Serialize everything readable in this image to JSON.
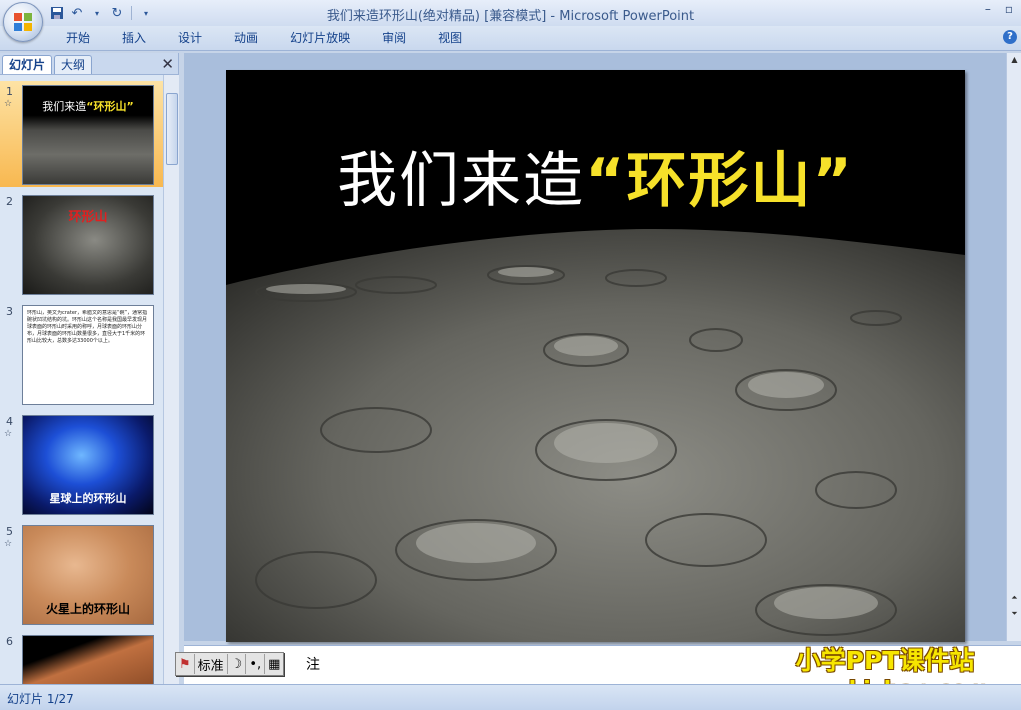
{
  "window": {
    "title": "我们来造环形山(绝对精品) [兼容模式] - Microsoft PowerPoint",
    "minimize": "–",
    "restore": "▫"
  },
  "qat": {
    "save_icon": "save-icon",
    "undo_icon": "undo-icon",
    "redo_icon": "redo-icon"
  },
  "ribbon": {
    "tabs": [
      "开始",
      "插入",
      "设计",
      "动画",
      "幻灯片放映",
      "审阅",
      "视图"
    ],
    "help": "?"
  },
  "panel": {
    "tabs": [
      "幻灯片",
      "大纲"
    ],
    "close": "✕",
    "slides": [
      {
        "num": "1",
        "star": "☆",
        "caption_a": "我们来造",
        "caption_b": "“环形山”"
      },
      {
        "num": "2",
        "caption": "环形山"
      },
      {
        "num": "3",
        "caption": "环形山，英文为crater，希腊文的意思是“碗”，通常指碗状凹坑结构的坑。环形山这个名称是我国最早发现月球表面的环形山时采用的称呼，月球表面的环形山分布，月球表面的环形山数量很多，直径大于1千米的环形山比较大，总数多达33000个以上。"
      },
      {
        "num": "4",
        "star": "☆",
        "caption": "星球上的环形山"
      },
      {
        "num": "5",
        "star": "☆",
        "caption": "火星上的环形山"
      },
      {
        "num": "6"
      }
    ]
  },
  "slide": {
    "title_a": "我们来造",
    "title_b": "“环形山”"
  },
  "notes": {
    "text": "注"
  },
  "ime": {
    "mode": "标准",
    "moon": "☽",
    "punct": "•,",
    "kbd": "▦"
  },
  "status": {
    "text": "幻灯片 1/27"
  },
  "watermark": {
    "line1": "小学PPT课件站",
    "line2": "www.kjzhan.com"
  },
  "colors": {
    "title_highlight": "#f6e12a",
    "selected_thumb": "#f8b850",
    "ribbon": "#c9d8ee"
  }
}
